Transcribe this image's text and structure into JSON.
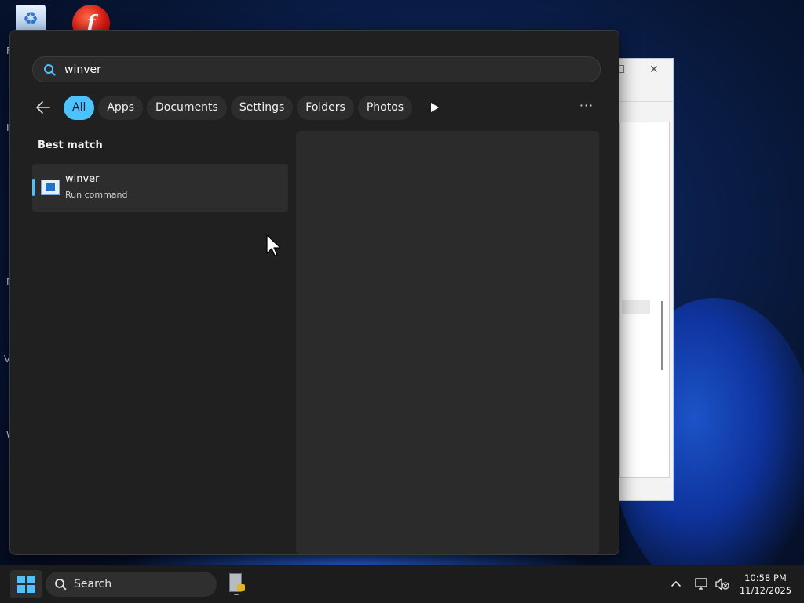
{
  "search": {
    "query": "winver"
  },
  "filters": [
    {
      "label": "All",
      "active": true
    },
    {
      "label": "Apps",
      "active": false
    },
    {
      "label": "Documents",
      "active": false
    },
    {
      "label": "Settings",
      "active": false
    },
    {
      "label": "Folders",
      "active": false
    },
    {
      "label": "Photos",
      "active": false
    }
  ],
  "more_label": "···",
  "results": {
    "section_title": "Best match",
    "best_match": {
      "name": "winver",
      "type": "Run command",
      "icon": "winver-app-icon"
    }
  },
  "taskbar": {
    "search_label": "Search",
    "time": "10:58 PM",
    "date": "11/12/2025"
  },
  "desktop": {
    "edge_letters": [
      "F",
      "I",
      "N",
      "V",
      "W"
    ]
  },
  "icons": {
    "search": "search-icon",
    "back": "back-arrow-icon",
    "play": "play-icon",
    "start": "windows-start-icon",
    "network": "network-icon",
    "volume": "volume-muted-icon",
    "chevron": "chevron-up-icon"
  },
  "colors": {
    "accent": "#4cc2ff",
    "panel_bg": "#202020",
    "taskbar_bg": "#1c1c1c"
  }
}
